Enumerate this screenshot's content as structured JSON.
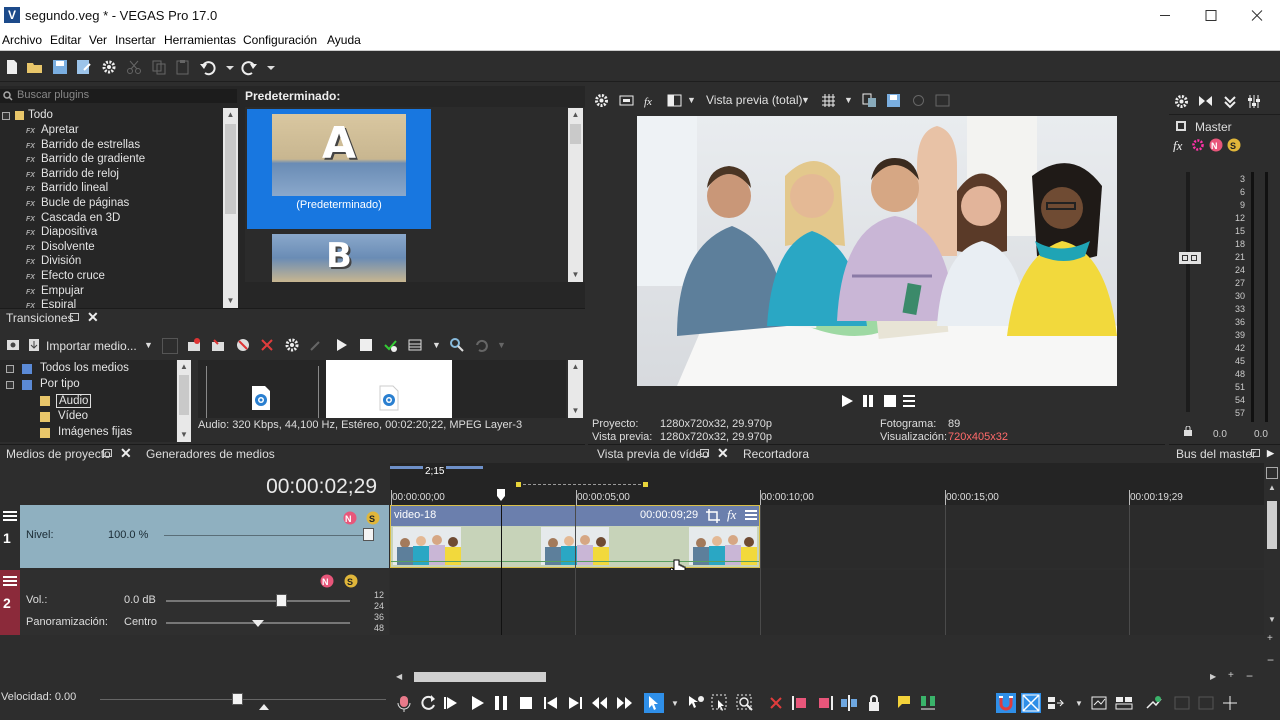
{
  "window": {
    "app_icon": "V",
    "title": "segundo.veg * - VEGAS Pro 17.0",
    "controls": [
      "minimize-icon",
      "maximize-icon",
      "close-icon"
    ]
  },
  "menu": [
    "Archivo",
    "Editar",
    "Ver",
    "Insertar",
    "Herramientas",
    "Configuración",
    "Ayuda"
  ],
  "toolbar_icons": [
    "new-file-icon",
    "open-folder-icon",
    "save-icon",
    "save-as-icon",
    "settings-gear-icon",
    "cut-icon",
    "copy-icon",
    "paste-icon",
    "undo-icon",
    "undo-dropdown-icon",
    "redo-icon",
    "redo-dropdown-icon"
  ],
  "transitions": {
    "search_placeholder": "Buscar plugins",
    "root": "Todo",
    "fx_tag": "FX",
    "items": [
      "Apretar",
      "Barrido de estrellas",
      "Barrido de gradiente",
      "Barrido de reloj",
      "Barrido lineal",
      "Bucle de páginas",
      "Cascada en 3D",
      "Diapositiva",
      "Disolvente",
      "División",
      "Efecto cruce",
      "Empujar",
      "Espiral"
    ],
    "preset_header": "Predeterminado:",
    "presets": [
      {
        "glyph": "A",
        "label": "(Predeterminado)",
        "selected": true
      },
      {
        "glyph": "B",
        "label": "",
        "selected": false
      }
    ],
    "tab_label": "Transiciones"
  },
  "media": {
    "import_label": "Importar medio...",
    "tree": [
      {
        "label": "Todos los medios",
        "level": 0,
        "selected": false
      },
      {
        "label": "Por tipo",
        "level": 0,
        "selected": false
      },
      {
        "label": "Audio",
        "level": 1,
        "selected": true
      },
      {
        "label": "Vídeo",
        "level": 1,
        "selected": false
      },
      {
        "label": "Imágenes fijas",
        "level": 1,
        "selected": false
      }
    ],
    "status": "Audio: 320 Kbps, 44,100 Hz, Estéreo, 00:02:20;22, MPEG Layer-3",
    "tabs": [
      "Medios de proyecto",
      "Generadores de medios"
    ]
  },
  "preview": {
    "mode_label": "Vista previa (total)",
    "info": {
      "project_label": "Proyecto:",
      "project_value": "1280x720x32, 29.970p",
      "preview_label": "Vista previa:",
      "preview_value": "1280x720x32, 29.970p",
      "frame_label": "Fotograma:",
      "frame_value": "89",
      "display_label": "Visualización:",
      "display_value": "720x405x32"
    },
    "tabs": [
      "Vista previa de vídeo",
      "Recortadora"
    ],
    "accent_color": "#ff6a6a"
  },
  "master": {
    "label": "Master",
    "scale": [
      "3",
      "6",
      "9",
      "12",
      "15",
      "18",
      "21",
      "24",
      "27",
      "30",
      "33",
      "36",
      "39",
      "42",
      "45",
      "48",
      "51",
      "54",
      "57"
    ],
    "left_value": "0.0",
    "right_value": "0.0",
    "tab_label": "Bus del master"
  },
  "timeline": {
    "timecode": "00:00:02;29",
    "selection_length": "2;15",
    "ruler": [
      "00:00:00;00",
      "00:00:05;00",
      "00:00:10;00",
      "00:00:15;00",
      "00:00:19;29"
    ],
    "tracks": [
      {
        "number": "1",
        "param_label": "Nivel:",
        "param_value": "100.0 %",
        "level": 1.0
      },
      {
        "number": "2",
        "param_label": "Vol.:",
        "param_value": "0.0 dB",
        "pan_label": "Panoramización:",
        "pan_value": "Centro",
        "db_scale": [
          "12",
          "24",
          "36",
          "48"
        ]
      }
    ],
    "clip": {
      "name": "video-18",
      "duration": "00:00:09;29",
      "fx": "fx"
    },
    "rate_label": "Velocidad: 0.00",
    "track1_color": "#8fb0c0",
    "track2_color": "#8b2a3a"
  },
  "transport_icons": [
    "record-icon",
    "loop-icon",
    "play-from-start-icon",
    "play-icon",
    "pause-icon",
    "stop-icon",
    "prev-marker-icon",
    "next-marker-icon",
    "prev-frame-icon",
    "next-frame-icon",
    "normal-edit-tool-icon",
    "envelope-tool-icon",
    "selection-tool-icon",
    "zoom-tool-icon",
    "delete-icon",
    "trim-start-icon",
    "trim-end-icon",
    "split-icon",
    "lock-icon",
    "marker-icon",
    "region-icon",
    "snap-icon",
    "auto-crossfade-icon",
    "ripple-icon",
    "lock-envelopes-icon",
    "ignore-grouping-icon",
    "autotune-icon"
  ]
}
